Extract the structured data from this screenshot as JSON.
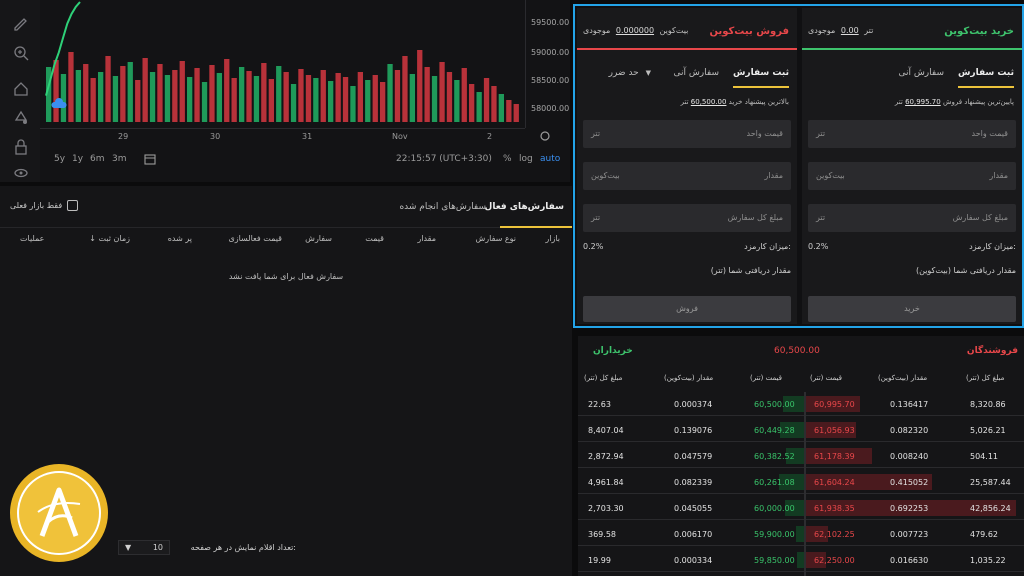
{
  "chart": {
    "price_ticks": [
      "59500.00",
      "59000.00",
      "58500.00",
      "58000.00"
    ],
    "time_ticks": [
      "29",
      "30",
      "31",
      "Nov",
      "2"
    ],
    "ranges": [
      "5y",
      "1y",
      "6m",
      "3m"
    ],
    "clock": "22:15:57 (UTC+3:30)",
    "percent": "%",
    "log": "log",
    "auto": "auto",
    "icons": [
      "pencil-icon",
      "zoom-icon",
      "home-icon",
      "paint-icon",
      "lock-icon",
      "eye-icon",
      "calendar-icon",
      "cloud-icon",
      "settings-icon"
    ],
    "bars": [
      {
        "v": 0.55,
        "c": "g"
      },
      {
        "v": 0.62,
        "c": "r"
      },
      {
        "v": 0.48,
        "c": "g"
      },
      {
        "v": 0.7,
        "c": "r"
      },
      {
        "v": 0.52,
        "c": "g"
      },
      {
        "v": 0.58,
        "c": "r"
      },
      {
        "v": 0.44,
        "c": "r"
      },
      {
        "v": 0.5,
        "c": "g"
      },
      {
        "v": 0.66,
        "c": "r"
      },
      {
        "v": 0.46,
        "c": "g"
      },
      {
        "v": 0.56,
        "c": "r"
      },
      {
        "v": 0.6,
        "c": "g"
      },
      {
        "v": 0.42,
        "c": "r"
      },
      {
        "v": 0.64,
        "c": "r"
      },
      {
        "v": 0.5,
        "c": "g"
      },
      {
        "v": 0.58,
        "c": "r"
      },
      {
        "v": 0.47,
        "c": "g"
      },
      {
        "v": 0.52,
        "c": "r"
      },
      {
        "v": 0.61,
        "c": "r"
      },
      {
        "v": 0.45,
        "c": "g"
      },
      {
        "v": 0.54,
        "c": "r"
      },
      {
        "v": 0.4,
        "c": "g"
      },
      {
        "v": 0.57,
        "c": "r"
      },
      {
        "v": 0.49,
        "c": "g"
      },
      {
        "v": 0.63,
        "c": "r"
      },
      {
        "v": 0.44,
        "c": "r"
      },
      {
        "v": 0.55,
        "c": "g"
      },
      {
        "v": 0.51,
        "c": "r"
      },
      {
        "v": 0.46,
        "c": "g"
      },
      {
        "v": 0.59,
        "c": "r"
      },
      {
        "v": 0.43,
        "c": "r"
      },
      {
        "v": 0.56,
        "c": "g"
      },
      {
        "v": 0.5,
        "c": "r"
      },
      {
        "v": 0.38,
        "c": "g"
      },
      {
        "v": 0.53,
        "c": "r"
      },
      {
        "v": 0.47,
        "c": "r"
      },
      {
        "v": 0.44,
        "c": "g"
      },
      {
        "v": 0.52,
        "c": "r"
      },
      {
        "v": 0.41,
        "c": "g"
      },
      {
        "v": 0.49,
        "c": "r"
      },
      {
        "v": 0.45,
        "c": "r"
      },
      {
        "v": 0.36,
        "c": "g"
      },
      {
        "v": 0.5,
        "c": "r"
      },
      {
        "v": 0.42,
        "c": "g"
      },
      {
        "v": 0.47,
        "c": "r"
      },
      {
        "v": 0.4,
        "c": "r"
      },
      {
        "v": 0.58,
        "c": "g"
      },
      {
        "v": 0.52,
        "c": "r"
      },
      {
        "v": 0.66,
        "c": "r"
      },
      {
        "v": 0.48,
        "c": "g"
      },
      {
        "v": 0.72,
        "c": "r"
      },
      {
        "v": 0.55,
        "c": "r"
      },
      {
        "v": 0.46,
        "c": "g"
      },
      {
        "v": 0.6,
        "c": "r"
      },
      {
        "v": 0.5,
        "c": "r"
      },
      {
        "v": 0.42,
        "c": "g"
      },
      {
        "v": 0.54,
        "c": "r"
      },
      {
        "v": 0.38,
        "c": "r"
      },
      {
        "v": 0.3,
        "c": "g"
      },
      {
        "v": 0.44,
        "c": "r"
      },
      {
        "v": 0.36,
        "c": "r"
      },
      {
        "v": 0.28,
        "c": "g"
      },
      {
        "v": 0.22,
        "c": "r"
      },
      {
        "v": 0.18,
        "c": "r"
      }
    ],
    "price_line": [
      0.22,
      0.35,
      0.48,
      0.58,
      0.7,
      0.82,
      0.9,
      0.96,
      1.0
    ],
    "colors": {
      "up": "#1f9a5a",
      "down": "#b8323a",
      "line": "#2ed178"
    }
  },
  "orders": {
    "tab_active": "سفارش‌های فعال",
    "tab_done": "سفارش‌های انجام شده",
    "current_market_only": "فقط بازار فعلی",
    "columns": [
      "بازار",
      "نوع سفارش",
      "مقدار",
      "قیمت",
      "سفارش",
      "قیمت فعالسازی",
      "پر شده",
      "زمان ثبت",
      "عملیات"
    ],
    "sort_arrow": "↓",
    "empty_message": "سفارش فعال برای شما یافت نشد",
    "pager_label": "تعداد اقلام نمایش در هر صفحه:",
    "pager_value": "10",
    "pager_caret": "▼"
  },
  "trade": {
    "sell": {
      "title": "فروش بیت‌کوین",
      "balance_label": "موجودی",
      "balance_value": "0.000000",
      "balance_unit": "بیت‌کوین",
      "tabs": [
        "ثبت سفارش",
        "سفارش آنی",
        "حد ضرر"
      ],
      "tab_caret": "▼",
      "best_label": "بالاترین پیشنهاد خرید",
      "best_value": "60,500.00",
      "best_unit": "تتر",
      "price_placeholder": "قیمت واحد",
      "price_unit": "تتر",
      "amount_placeholder": "مقدار",
      "amount_unit": "بیت‌کوین",
      "total_placeholder": "مبلغ کل سفارش",
      "total_unit": "تتر",
      "fee_label": "میزان کارمزد:",
      "fee_value": "0.2%",
      "receive_label": "مقدار دریافتی شما (تتر)",
      "submit": "فروش",
      "accent": "#e8474a"
    },
    "buy": {
      "title": "خرید بیت‌کوین",
      "balance_label": "موجودی",
      "balance_value": "0.00",
      "balance_unit": "تتر",
      "tabs": [
        "ثبت سفارش",
        "سفارش آنی"
      ],
      "best_label": "پایین‌ترین پیشنهاد فروش",
      "best_value": "60,995.70",
      "best_unit": "تتر",
      "price_placeholder": "قیمت واحد",
      "price_unit": "تتر",
      "amount_placeholder": "مقدار",
      "amount_unit": "بیت‌کوین",
      "total_placeholder": "مبلغ کل سفارش",
      "total_unit": "تتر",
      "fee_label": "میزان کارمزد:",
      "fee_value": "0.2%",
      "receive_label": "مقدار دریافتی شما (بیت‌کوین)",
      "submit": "خرید",
      "accent": "#3ec46d"
    }
  },
  "book": {
    "buyers_label": "خریداران",
    "sellers_label": "فروشندگان",
    "last_price": "60,500.00",
    "columns": {
      "bid_total": "مبلغ کل (تتر)",
      "bid_amount": "مقدار (بیت‌کوین)",
      "bid_price": "قیمت (تتر)",
      "ask_price": "قیمت (تتر)",
      "ask_amount": "مقدار (بیت‌کوین)",
      "ask_total": "مبلغ کل (تتر)"
    },
    "rows": [
      {
        "bid_total": "22.63",
        "bid_amount": "0.000374",
        "bid_price": "60,500.00",
        "bid_depth": 0.25,
        "ask_price": "60,995.70",
        "ask_amount": "0.136417",
        "ask_total": "8,320.86",
        "ask_depth": 0.22
      },
      {
        "bid_total": "8,407.04",
        "bid_amount": "0.139076",
        "bid_price": "60,449.28",
        "bid_depth": 0.3,
        "ask_price": "61,056.93",
        "ask_amount": "0.082320",
        "ask_total": "5,026.21",
        "ask_depth": 0.2
      },
      {
        "bid_total": "2,872.94",
        "bid_amount": "0.047579",
        "bid_price": "60,382.52",
        "bid_depth": 0.2,
        "ask_price": "61,178.39",
        "ask_amount": "0.008240",
        "ask_total": "504.11",
        "ask_depth": 0.28
      },
      {
        "bid_total": "4,961.84",
        "bid_amount": "0.082339",
        "bid_price": "60,261.08",
        "bid_depth": 0.32,
        "ask_price": "61,604.24",
        "ask_amount": "0.415052",
        "ask_total": "25,587.44",
        "ask_depth": 0.58
      },
      {
        "bid_total": "2,703.30",
        "bid_amount": "0.045055",
        "bid_price": "60,000.00",
        "bid_depth": 0.22,
        "ask_price": "61,938.35",
        "ask_amount": "0.692253",
        "ask_total": "42,856.24",
        "ask_depth": 1.0
      },
      {
        "bid_total": "369.58",
        "bid_amount": "0.006170",
        "bid_price": "59,900.00",
        "bid_depth": 0.04,
        "ask_price": "62,102.25",
        "ask_amount": "0.007723",
        "ask_total": "479.62",
        "ask_depth": 0.06
      },
      {
        "bid_total": "19.99",
        "bid_amount": "0.000334",
        "bid_price": "59,850.00",
        "bid_depth": 0.02,
        "ask_price": "62,250.00",
        "ask_amount": "0.016630",
        "ask_total": "1,035.22",
        "ask_depth": 0.05
      }
    ]
  }
}
